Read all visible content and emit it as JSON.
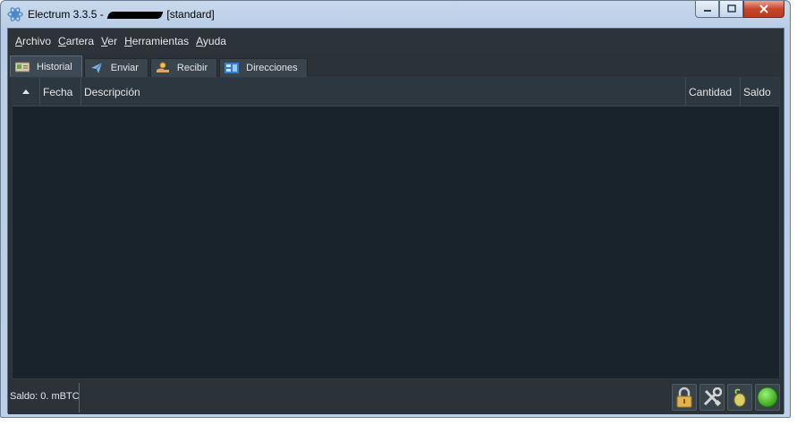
{
  "window": {
    "title_prefix": "Electrum 3.3.5  -",
    "title_suffix": "[standard]"
  },
  "menubar": {
    "items": [
      {
        "key": "A",
        "rest": "rchivo"
      },
      {
        "key": "C",
        "rest": "artera"
      },
      {
        "key": "V",
        "rest": "er"
      },
      {
        "key": "H",
        "rest": "erramientas"
      },
      {
        "key": "A",
        "rest": "yuda"
      }
    ]
  },
  "tabs": [
    {
      "label": "Historial",
      "icon": "history-icon",
      "active": true
    },
    {
      "label": "Enviar",
      "icon": "send-icon",
      "active": false
    },
    {
      "label": "Recibir",
      "icon": "receive-icon",
      "active": false
    },
    {
      "label": "Direcciones",
      "icon": "addresses-icon",
      "active": false
    }
  ],
  "table": {
    "columns": [
      "Fecha",
      "Descripción",
      "Cantidad",
      "Saldo"
    ],
    "rows": []
  },
  "status": {
    "balance": "Saldo: 0. mBTC"
  },
  "colors": {
    "background": "#19232c",
    "panel": "#2b3238",
    "text": "#e6e6e6",
    "online": "#3cb81e"
  }
}
